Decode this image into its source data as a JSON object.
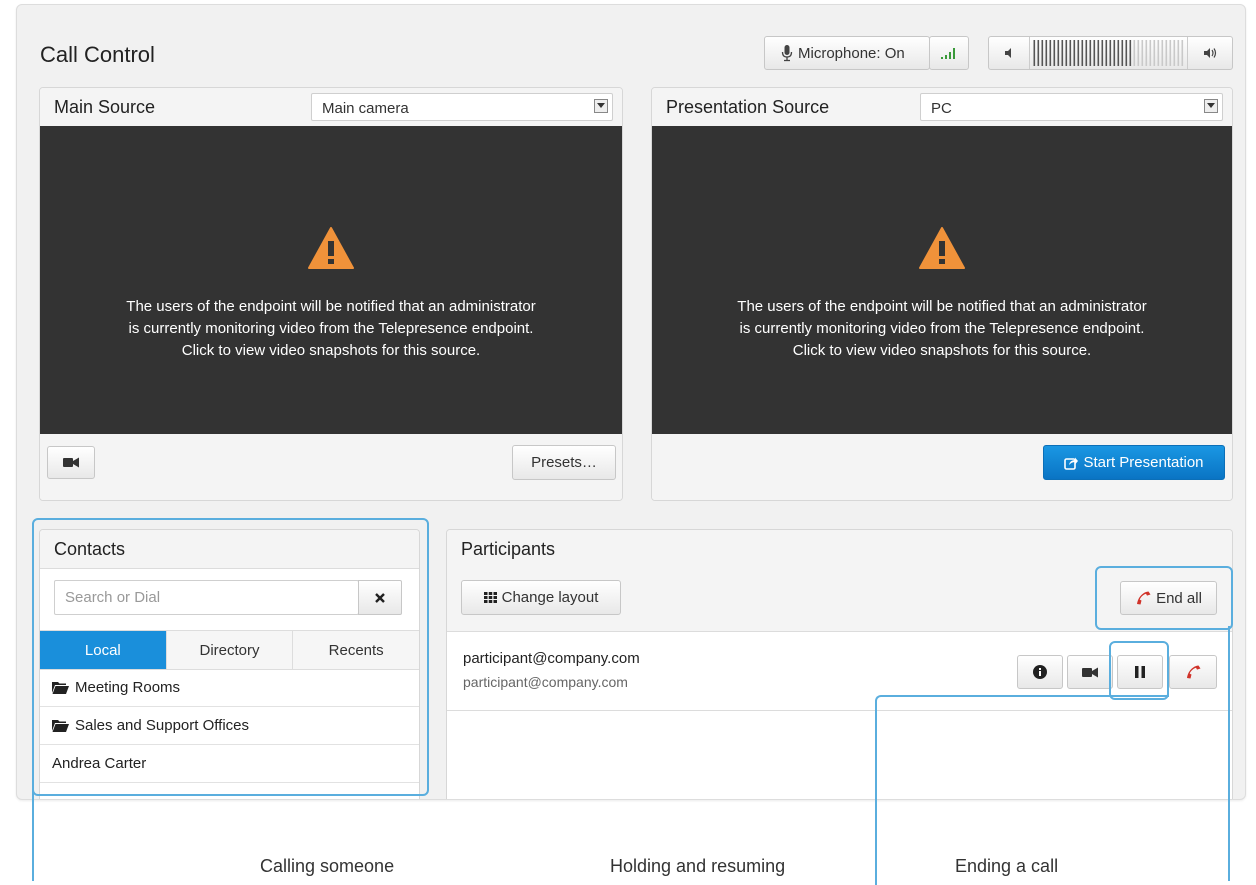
{
  "header": {
    "title": "Call Control",
    "microphone_label": "Microphone: On",
    "volume_level": 0.65
  },
  "main_source": {
    "title": "Main Source",
    "selected": "Main camera",
    "message_line1": "The users of the endpoint will be notified that an administrator",
    "message_line2": "is currently monitoring video from the Telepresence endpoint.",
    "message_line3": "Click to view video snapshots for this source.",
    "presets_label": "Presets…"
  },
  "presentation_source": {
    "title": "Presentation Source",
    "selected": "PC",
    "message_line1": "The users of the endpoint will be notified that an administrator",
    "message_line2": "is currently monitoring video from the Telepresence endpoint.",
    "message_line3": "Click to view video snapshots for this source.",
    "start_label": "Start Presentation"
  },
  "contacts": {
    "title": "Contacts",
    "search_placeholder": "Search or Dial",
    "tabs": [
      {
        "label": "Local"
      },
      {
        "label": "Directory"
      },
      {
        "label": "Recents"
      }
    ],
    "items": [
      {
        "label": "Meeting Rooms",
        "icon": "folder-icon"
      },
      {
        "label": "Sales and Support Offices",
        "icon": "folder-icon"
      },
      {
        "label": "Andrea Carter"
      }
    ]
  },
  "participants": {
    "title": "Participants",
    "change_layout_label": "Change layout",
    "end_all_label": "End all",
    "rows": [
      {
        "name": "participant@company.com",
        "address": "participant@company.com"
      }
    ]
  },
  "captions": {
    "calling": "Calling someone",
    "holding": "Holding and resuming",
    "ending": "Ending a call"
  },
  "colors": {
    "accent": "#1a8fdb",
    "video_bg": "#333333",
    "warning": "#f0923a",
    "hangup": "#d0332a",
    "annotation": "#5aaede"
  }
}
